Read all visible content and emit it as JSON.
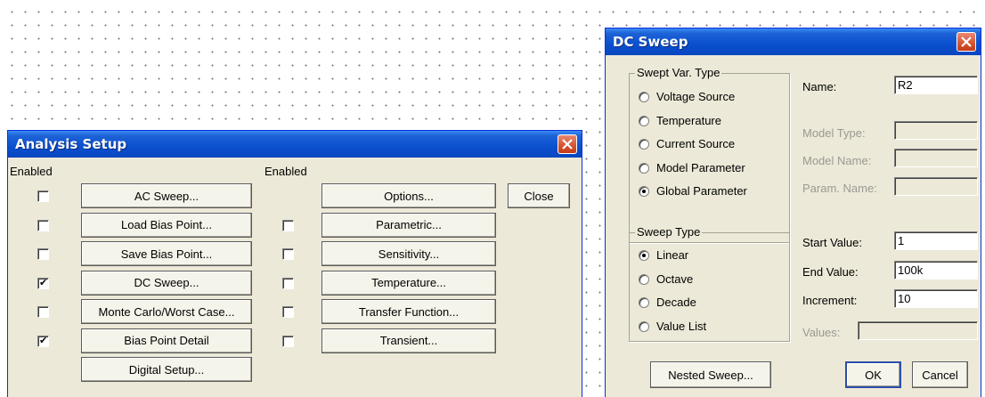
{
  "analysis_setup": {
    "title": "Analysis Setup",
    "enabled_header_left": "Enabled",
    "enabled_header_right": "Enabled",
    "close_label": "Close",
    "left_rows": [
      {
        "label": "AC Sweep...",
        "checked": false,
        "has_checkbox": true
      },
      {
        "label": "Load Bias Point...",
        "checked": false,
        "has_checkbox": true
      },
      {
        "label": "Save Bias Point...",
        "checked": false,
        "has_checkbox": true
      },
      {
        "label": "DC Sweep...",
        "checked": true,
        "has_checkbox": true
      },
      {
        "label": "Monte Carlo/Worst Case...",
        "checked": false,
        "has_checkbox": true
      },
      {
        "label": "Bias Point Detail",
        "checked": true,
        "has_checkbox": true
      },
      {
        "label": "Digital Setup...",
        "checked": false,
        "has_checkbox": false
      }
    ],
    "right_rows": [
      {
        "label": "Options...",
        "checked": false,
        "has_checkbox": false
      },
      {
        "label": "Parametric...",
        "checked": false,
        "has_checkbox": true
      },
      {
        "label": "Sensitivity...",
        "checked": false,
        "has_checkbox": true
      },
      {
        "label": "Temperature...",
        "checked": false,
        "has_checkbox": true
      },
      {
        "label": "Transfer Function...",
        "checked": false,
        "has_checkbox": true
      },
      {
        "label": "Transient...",
        "checked": false,
        "has_checkbox": true
      }
    ]
  },
  "dc_sweep": {
    "title": "DC Sweep",
    "swept_var_type": {
      "legend": "Swept Var. Type",
      "options": [
        "Voltage Source",
        "Temperature",
        "Current Source",
        "Model Parameter",
        "Global Parameter"
      ],
      "selected": "Global Parameter"
    },
    "sweep_type": {
      "legend": "Sweep Type",
      "options": [
        "Linear",
        "Octave",
        "Decade",
        "Value List"
      ],
      "selected": "Linear"
    },
    "fields": {
      "name_label": "Name:",
      "name_value": "R2",
      "model_type_label": "Model Type:",
      "model_type_value": "",
      "model_name_label": "Model Name:",
      "model_name_value": "",
      "param_name_label": "Param. Name:",
      "param_name_value": "",
      "start_label": "Start Value:",
      "start_value": "1",
      "end_label": "End Value:",
      "end_value": "100k",
      "increment_label": "Increment:",
      "increment_value": "10",
      "values_label": "Values:",
      "values_value": ""
    },
    "nested_sweep_label": "Nested Sweep...",
    "ok_label": "OK",
    "cancel_label": "Cancel"
  }
}
